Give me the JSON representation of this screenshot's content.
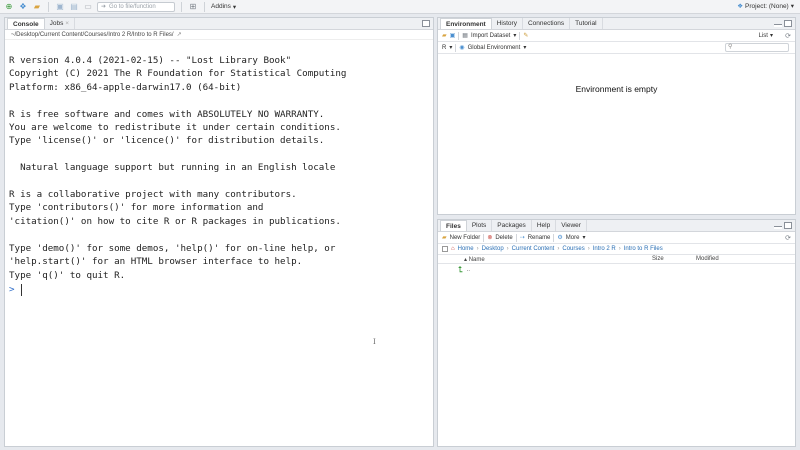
{
  "toolbar": {
    "goto_placeholder": "Go to file/function",
    "addins_label": "Addins",
    "project_label": "Project: (None)"
  },
  "console": {
    "tabs": [
      "Console",
      "Jobs"
    ],
    "path": "~/Desktop/Current Content/Courses/Intro 2 R/Intro to R Files/",
    "output": "R version 4.0.4 (2021-02-15) -- \"Lost Library Book\"\nCopyright (C) 2021 The R Foundation for Statistical Computing\nPlatform: x86_64-apple-darwin17.0 (64-bit)\n\nR is free software and comes with ABSOLUTELY NO WARRANTY.\nYou are welcome to redistribute it under certain conditions.\nType 'license()' or 'licence()' for distribution details.\n\n  Natural language support but running in an English locale\n\nR is a collaborative project with many contributors.\nType 'contributors()' for more information and\n'citation()' on how to cite R or R packages in publications.\n\nType 'demo()' for some demos, 'help()' for on-line help, or\n'help.start()' for an HTML browser interface to help.\nType 'q()' to quit R.",
    "prompt": ">"
  },
  "environment": {
    "tabs": [
      "Environment",
      "History",
      "Connections",
      "Tutorial"
    ],
    "import_label": "Import Dataset",
    "list_label": "List",
    "lang_label": "R",
    "scope_label": "Global Environment",
    "empty_message": "Environment is empty"
  },
  "files": {
    "tabs": [
      "Files",
      "Plots",
      "Packages",
      "Help",
      "Viewer"
    ],
    "actions": {
      "new_folder": "New Folder",
      "delete": "Delete",
      "rename": "Rename",
      "more": "More"
    },
    "breadcrumbs": [
      "Home",
      "Desktop",
      "Current Content",
      "Courses",
      "Intro 2 R",
      "Intro to R Files"
    ],
    "columns": {
      "name": "Name",
      "size": "Size",
      "modified": "Modified"
    },
    "rows": [
      {
        "name": ".."
      }
    ]
  }
}
